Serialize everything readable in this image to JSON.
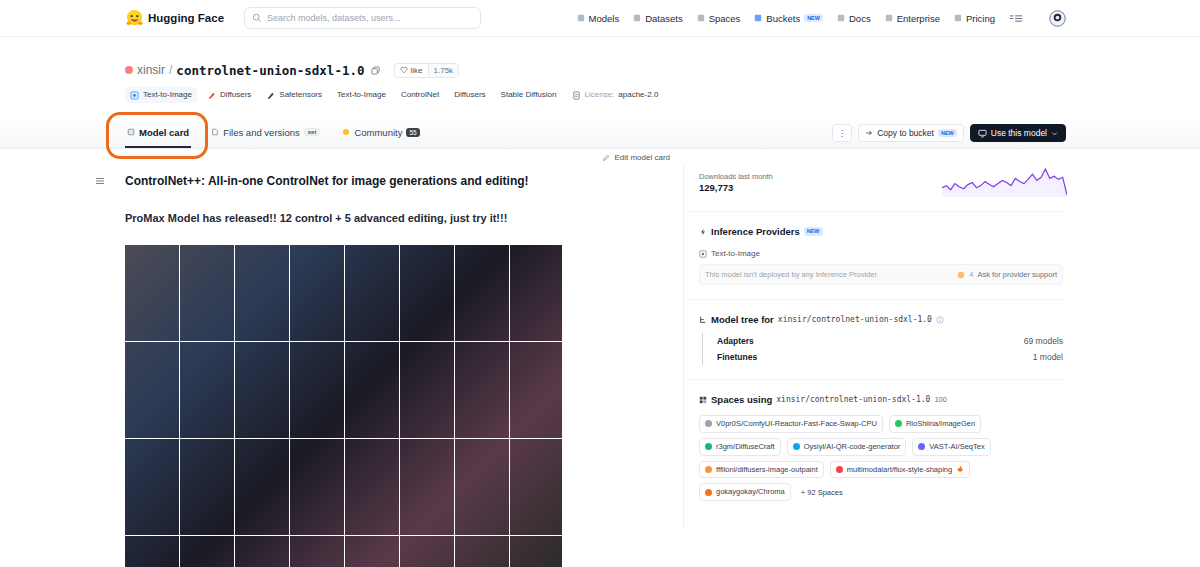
{
  "nav": {
    "brand": "Hugging Face",
    "search_placeholder": "Search models, datasets, users...",
    "items": [
      {
        "label": "Models"
      },
      {
        "label": "Datasets"
      },
      {
        "label": "Spaces"
      },
      {
        "label": "Buckets",
        "badge": "NEW"
      },
      {
        "label": "Docs"
      },
      {
        "label": "Enterprise"
      },
      {
        "label": "Pricing"
      }
    ]
  },
  "model": {
    "owner": "xinsir",
    "separator": "/",
    "name": "controlnet-union-sdxl-1.0",
    "like_label": "like",
    "likes": "1.75k"
  },
  "tags": [
    {
      "label": "Text-to-Image",
      "kind": "task"
    },
    {
      "label": "Diffusers",
      "kind": "library"
    },
    {
      "label": "Safetensors",
      "kind": "library"
    },
    {
      "label": "Text-to-Image",
      "kind": "plain"
    },
    {
      "label": "ControlNet",
      "kind": "plain"
    },
    {
      "label": "Diffusers",
      "kind": "plain"
    },
    {
      "label": "Stable Diffusion",
      "kind": "plain"
    },
    {
      "label": "apache-2.0",
      "kind": "license",
      "prefix": "License:"
    }
  ],
  "tabs": [
    {
      "label": "Model card",
      "selected": true
    },
    {
      "label": "Files and versions",
      "selected": false,
      "badge": "xet"
    },
    {
      "label": "Community",
      "selected": false,
      "count": "55"
    }
  ],
  "actions": {
    "more": "⋮",
    "copy": "Copy to bucket",
    "copy_badge": "NEW",
    "use": "Use this model"
  },
  "edit": "Edit model card",
  "content": {
    "title": "ControlNet++: All-in-one ControlNet for image generations and editing!",
    "subtitle": "ProMax Model has released!! 12 control + 5 advanced editing, just try it!!!"
  },
  "downloads": {
    "label": "Downloads last month",
    "value": "129,773",
    "series": [
      3900,
      4100,
      3700,
      4300,
      4000,
      3800,
      4200,
      4400,
      3900,
      4100,
      4500,
      4200,
      4000,
      4300,
      4600,
      4400,
      4100,
      4800,
      4500,
      4300,
      4700,
      5200,
      4600,
      4900,
      5700,
      4800,
      5000,
      4700,
      4900,
      3200
    ]
  },
  "inference": {
    "title": "Inference Providers",
    "badge": "NEW",
    "task": "Text-to-Image",
    "message": "This model isn't deployed by any Inference Provider.",
    "votes": "4",
    "ask": "Ask for provider support"
  },
  "tree": {
    "title": "Model tree for",
    "repo": "xinsir/controlnet-union-sdxl-1.0",
    "rows": [
      {
        "label": "Adapters",
        "value": "69 models"
      },
      {
        "label": "Finetunes",
        "value": "1 model"
      }
    ]
  },
  "spaces": {
    "title": "Spaces using",
    "repo": "xinsir/controlnet-union-sdxl-1.0",
    "count": "100",
    "items": [
      {
        "label": "V0pr0S/ComfyUI-Reactor-Fast-Face-Swap-CPU",
        "color": "#9ca3af",
        "hot": false
      },
      {
        "label": "RioShiina/ImageGen",
        "color": "#22c55e",
        "hot": false
      },
      {
        "label": "r3gm/DiffuseCraft",
        "color": "#10b981",
        "hot": false
      },
      {
        "label": "Oysiyl/AI-QR-code-generator",
        "color": "#0ea5e9",
        "hot": false
      },
      {
        "label": "VAST-AI/SeqTex",
        "color": "#6366f1",
        "hot": false
      },
      {
        "label": "fffiloni/diffusers-image-outpaint",
        "color": "#fb923c",
        "hot": false
      },
      {
        "label": "multimodalart/flux-style-shaping",
        "color": "#ef4444",
        "hot": true
      },
      {
        "label": "gokaygokay/Chroma",
        "color": "#f97316",
        "hot": false
      }
    ],
    "more": "+ 92 Spaces"
  }
}
